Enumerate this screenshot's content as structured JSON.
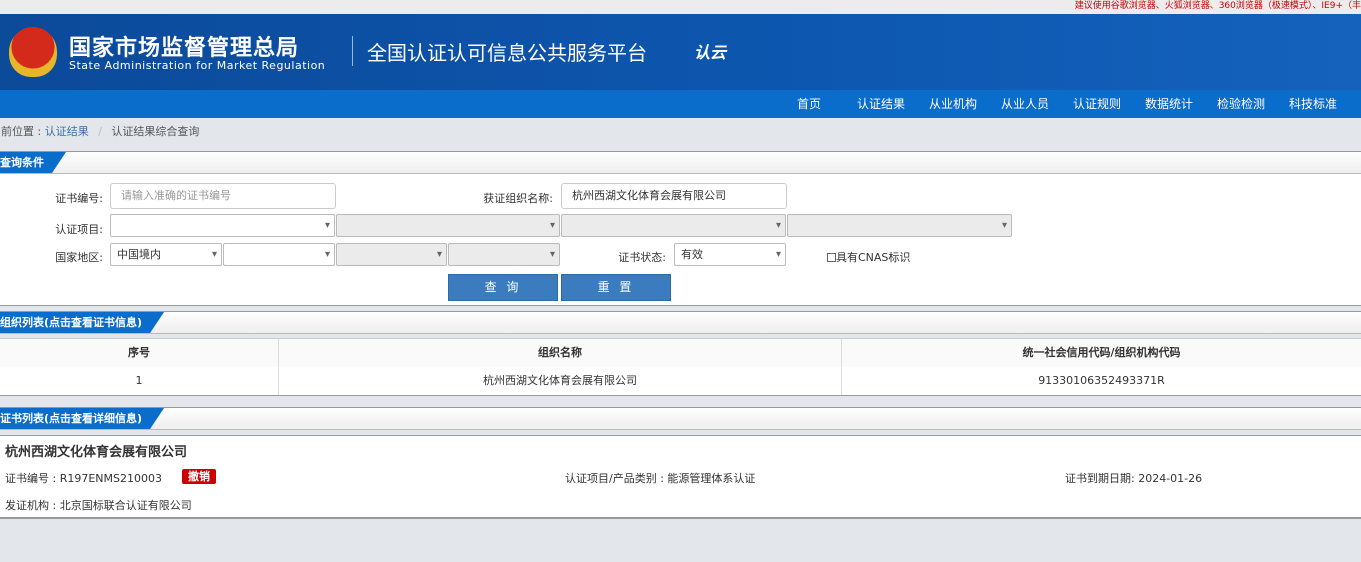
{
  "top_tip": "建议使用谷歌浏览器、火狐浏览器、360浏览器（极速模式）、IE9+（丰",
  "header": {
    "title_cn": "国家市场监督管理总局",
    "title_en": "State Administration  for  Market Regulation",
    "platform": "全国认证认可信息公共服务平台",
    "logo_text": "认云"
  },
  "nav": [
    "首页",
    "认证结果",
    "从业机构",
    "从业人员",
    "认证规则",
    "数据统计",
    "检验检测",
    "科技标准"
  ],
  "breadcrumb": {
    "prefix": "当前位置 :",
    "items": [
      "认证结果",
      "认证结果综合查询"
    ],
    "sep": "/"
  },
  "query": {
    "section_title": "查询条件",
    "cert_no_label": "证书编号:",
    "cert_no_placeholder": "请输入准确的证书编号",
    "org_label": "获证组织名称:",
    "org_value": "杭州西湖文化体育会展有限公司",
    "project_label": "认证项目:",
    "region_label": "国家地区:",
    "region_value": "中国境内",
    "status_label": "证书状态:",
    "status_value": "有效",
    "cnas_label": "具有CNAS标识",
    "search_button": "查 询",
    "reset_button": "重 置"
  },
  "org_list": {
    "section_title": "组织列表(点击查看证书信息)",
    "columns": [
      "序号",
      "组织名称",
      "统一社会信用代码/组织机构代码"
    ],
    "rows": [
      [
        "1",
        "杭州西湖文化体育会展有限公司",
        "91330106352493371R"
      ]
    ]
  },
  "cert_list": {
    "section_title": "证书列表(点击查看详细信息)",
    "org_name": "杭州西湖文化体育会展有限公司",
    "cert_no": "证书编号 : R197ENMS210003",
    "status_badge": "撤销",
    "project": "认证项目/产品类别 : 能源管理体系认证",
    "expiry": "证书到期日期: 2024-01-26",
    "issuer": "发证机构 : 北京国标联合认证有限公司"
  }
}
